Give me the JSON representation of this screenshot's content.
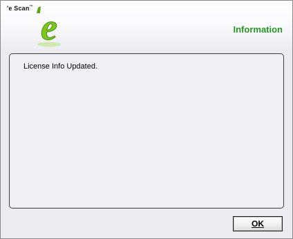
{
  "brand": {
    "name": "'e Scan",
    "trademark": "™",
    "logo_letter": "e"
  },
  "header": {
    "title": "Information"
  },
  "message": {
    "text": "License Info Updated."
  },
  "buttons": {
    "ok_label": "OK"
  },
  "colors": {
    "title_green": "#1e9a1e",
    "logo_green": "#6fbf1c",
    "body_background": "#ecebf0"
  }
}
